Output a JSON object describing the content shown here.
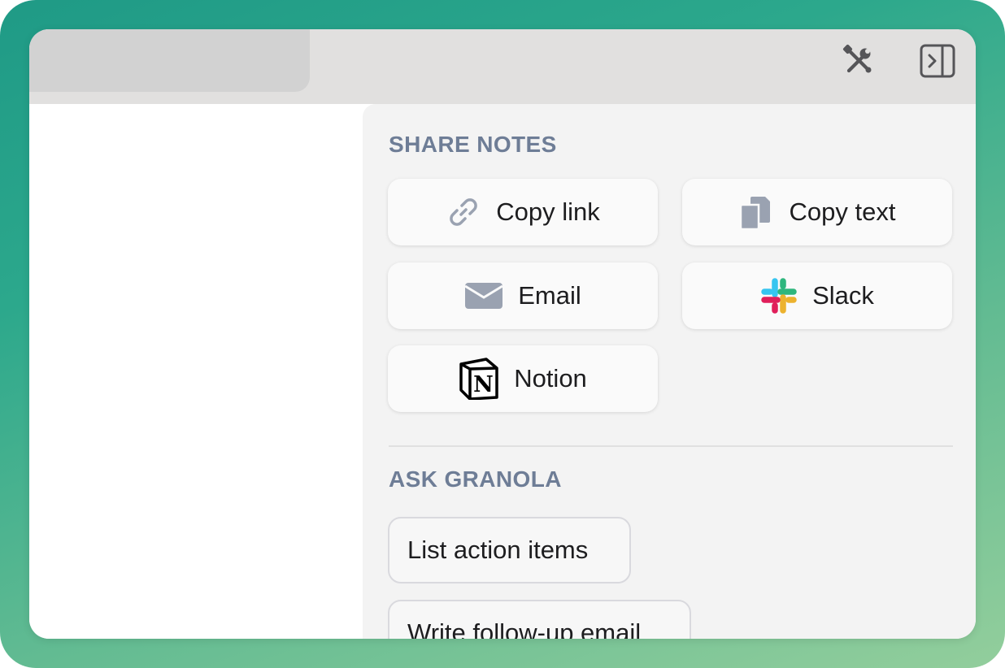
{
  "toolbar": {
    "tools_icon": "wrench-screwdriver-icon",
    "sidebar_icon": "sidebar-toggle-icon"
  },
  "share": {
    "title": "SHARE NOTES",
    "buttons": [
      {
        "label": "Copy link",
        "icon": "link-icon"
      },
      {
        "label": "Copy text",
        "icon": "copy-icon"
      },
      {
        "label": "Email",
        "icon": "envelope-icon"
      },
      {
        "label": "Slack",
        "icon": "slack-icon"
      },
      {
        "label": "Notion",
        "icon": "notion-icon"
      }
    ]
  },
  "ask": {
    "title": "ASK GRANOLA",
    "prompts": [
      {
        "label": "List action items"
      },
      {
        "label": "Write follow-up email"
      }
    ]
  },
  "colors": {
    "background_gradient_start": "#1f9a86",
    "background_gradient_end": "#93ce9c",
    "section_title": "#6e7d96",
    "icon_gray": "#9aa2b1",
    "slack_blue": "#36c5f0",
    "slack_green": "#2eb67d",
    "slack_yellow": "#ecb22e",
    "slack_red": "#e01e5a"
  }
}
